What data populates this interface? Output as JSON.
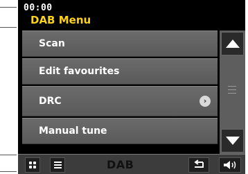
{
  "status": {
    "clock": "00:00",
    "menu_title": "DAB Menu"
  },
  "menu": {
    "items": [
      {
        "label": "Scan",
        "has_submenu": false
      },
      {
        "label": "Edit favourites",
        "has_submenu": false
      },
      {
        "label": "DRC",
        "has_submenu": true
      },
      {
        "label": "Manual tune",
        "has_submenu": false
      }
    ]
  },
  "bottom_bar": {
    "source_label": "DAB"
  },
  "icons": {
    "home": "grid-icon",
    "list": "list-icon",
    "back": "back-arrow-icon",
    "volume": "volume-icon",
    "scroll_up": "triangle-up-icon",
    "scroll_down": "triangle-down-icon",
    "submenu": "chevron-right-icon"
  },
  "colors": {
    "title": "#ffd21a",
    "screen_bg": "#000000",
    "item_bg": "#636363",
    "bottom_bar_bg": "#3c3c3c"
  }
}
